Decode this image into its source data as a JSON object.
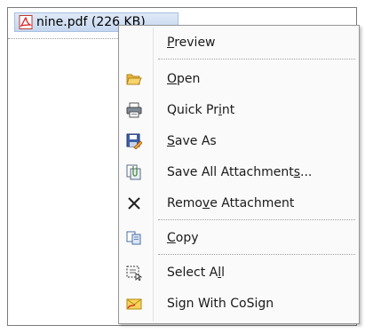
{
  "attachment": {
    "label": "nine.pdf (226 KB)"
  },
  "menu": {
    "items": [
      {
        "label": "Preview",
        "icon": "none",
        "mnemonic_index": 0
      },
      {
        "label": "Open",
        "icon": "open-folder-icon",
        "mnemonic_index": 0
      },
      {
        "label": "Quick Print",
        "icon": "printer-icon",
        "mnemonic_index": 8
      },
      {
        "label": "Save As",
        "icon": "save-as-icon",
        "mnemonic_index": 0
      },
      {
        "label": "Save All Attachments...",
        "icon": "save-all-attachments-icon",
        "mnemonic_index": 19
      },
      {
        "label": "Remove Attachment",
        "icon": "remove-x-icon",
        "mnemonic_index": 4
      },
      {
        "label": "Copy",
        "icon": "copy-icon",
        "mnemonic_index": 0
      },
      {
        "label": "Select All",
        "icon": "select-all-icon",
        "mnemonic_index": 8
      },
      {
        "label": "Sign With CoSign",
        "icon": "cosign-icon",
        "mnemonic_index": -1
      }
    ]
  },
  "colors": {
    "chip_bg": "#c6d7ef",
    "menu_bg": "#fafafa",
    "pdf_red": "#d8201f"
  }
}
